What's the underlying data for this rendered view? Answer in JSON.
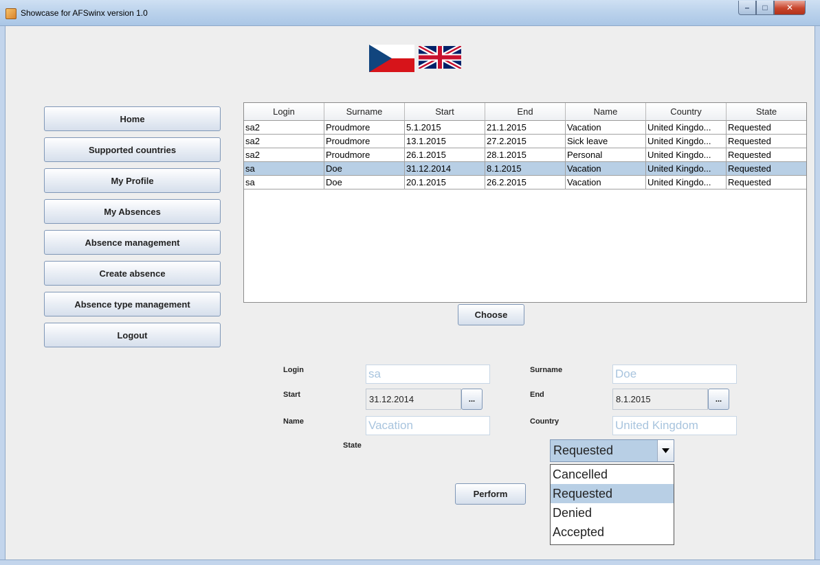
{
  "window": {
    "title": "Showcase for AFSwinx version 1.0",
    "minimize_glyph": "–",
    "maximize_glyph": "□",
    "close_glyph": "✕"
  },
  "flags": [
    {
      "icon": "czech-flag-icon"
    },
    {
      "icon": "uk-flag-icon"
    }
  ],
  "menu": {
    "items": [
      {
        "label": "Home"
      },
      {
        "label": "Supported countries"
      },
      {
        "label": "My Profile"
      },
      {
        "label": "My Absences"
      },
      {
        "label": "Absence management"
      },
      {
        "label": "Create absence"
      },
      {
        "label": "Absence type management"
      },
      {
        "label": "Logout"
      }
    ]
  },
  "table": {
    "columns": [
      "Login",
      "Surname",
      "Start",
      "End",
      "Name",
      "Country",
      "State"
    ],
    "rows": [
      [
        "sa2",
        "Proudmore",
        "5.1.2015",
        "21.1.2015",
        "Vacation",
        "United Kingdo...",
        "Requested"
      ],
      [
        "sa2",
        "Proudmore",
        "13.1.2015",
        "27.2.2015",
        "Sick leave",
        "United Kingdo...",
        "Requested"
      ],
      [
        "sa2",
        "Proudmore",
        "26.1.2015",
        "28.1.2015",
        "Personal",
        "United Kingdo...",
        "Requested"
      ],
      [
        "sa",
        "Doe",
        "31.12.2014",
        "8.1.2015",
        "Vacation",
        "United Kingdo...",
        "Requested"
      ],
      [
        "sa",
        "Doe",
        "20.1.2015",
        "26.2.2015",
        "Vacation",
        "United Kingdo...",
        "Requested"
      ]
    ],
    "selected_row": 3
  },
  "choose_label": "Choose",
  "form": {
    "login": {
      "label": "Login",
      "value": "sa"
    },
    "surname": {
      "label": "Surname",
      "value": "Doe"
    },
    "start": {
      "label": "Start",
      "value": "31.12.2014",
      "picker": "..."
    },
    "end": {
      "label": "End",
      "value": "8.1.2015",
      "picker": "..."
    },
    "name": {
      "label": "Name",
      "value": "Vacation"
    },
    "country": {
      "label": "Country",
      "value": "United Kingdom"
    },
    "state": {
      "label": "State",
      "value": "Requested",
      "options": [
        "Cancelled",
        "Requested",
        "Denied",
        "Accepted"
      ],
      "highlighted": "Requested"
    }
  },
  "perform_label": "Perform",
  "colors": {
    "selection": "#b8cfe5",
    "disabled_text": "#a8c4de",
    "button_border": "#7e96b6"
  }
}
